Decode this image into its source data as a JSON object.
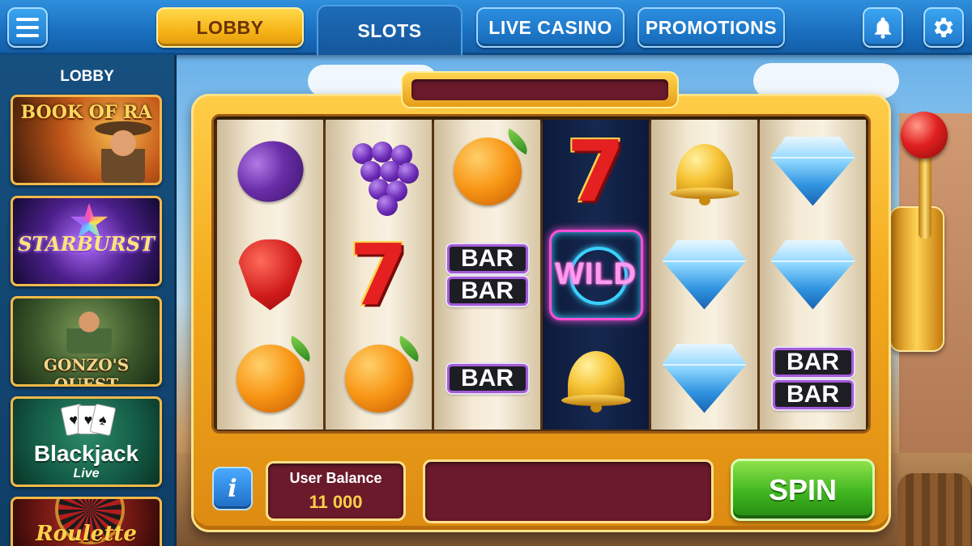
{
  "nav": {
    "tabs": [
      {
        "label": "LOBBY",
        "active": false,
        "highlighted": true
      },
      {
        "label": "SLOTS",
        "active": true
      },
      {
        "label": "LIVE CASINO",
        "active": false
      },
      {
        "label": "PROMOTIONS",
        "active": false
      }
    ],
    "icons": {
      "menu": "hamburger-menu-icon",
      "notifications": "bell-icon",
      "settings": "gear-icon"
    }
  },
  "sidebar": {
    "title": "LOBBY",
    "games": [
      {
        "title": "BOOK OF RA"
      },
      {
        "title": "STARBURST"
      },
      {
        "title": "GONZO'S QUEST"
      },
      {
        "title": "Blackjack",
        "subtitle": "Live"
      },
      {
        "title": "Roulette"
      }
    ]
  },
  "reels": [
    [
      "plum",
      "strawberry",
      "orange"
    ],
    [
      "grapes",
      "seven",
      "orange"
    ],
    [
      "orange",
      "bar-bar",
      "bar"
    ],
    [
      "seven",
      "wild",
      "bell"
    ],
    [
      "bell",
      "diamond",
      "diamond"
    ],
    [
      "diamond",
      "diamond",
      "bar-bar"
    ]
  ],
  "symbols": {
    "seven": "7",
    "bar": "BAR",
    "wild": "WILD"
  },
  "controls": {
    "info_label": "i",
    "balance_label": "User Balance",
    "balance_value": "11 000",
    "spin_label": "SPIN"
  },
  "colors": {
    "accent_gold": "#f6b417",
    "spin_green": "#3fb521",
    "nav_blue": "#1a6fbf",
    "panel_maroon": "#6a1a2a"
  }
}
